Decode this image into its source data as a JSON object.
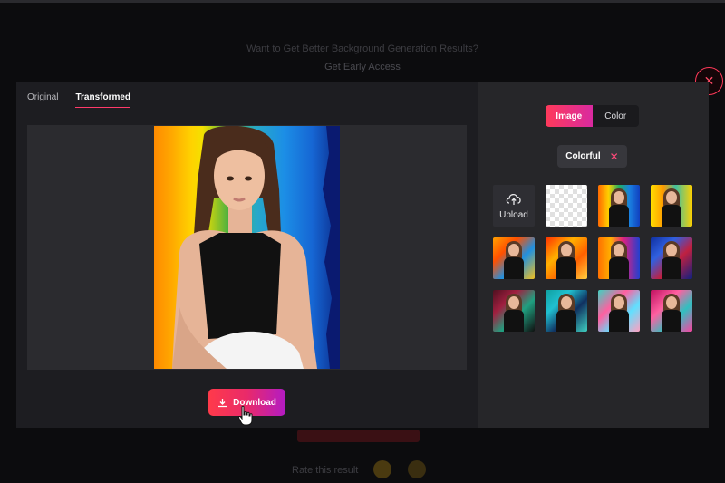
{
  "background": {
    "hint_line1": "Want to Get Better Background Generation Results?",
    "hint_line2": "Get Early Access",
    "feedback": "Rate this result"
  },
  "tabs": [
    {
      "label": "Original",
      "active": false
    },
    {
      "label": "Transformed",
      "active": true
    }
  ],
  "download": {
    "label": "Download"
  },
  "mode_switch": [
    {
      "label": "Image",
      "active": true
    },
    {
      "label": "Color",
      "active": false
    }
  ],
  "filter_chip": {
    "label": "Colorful"
  },
  "upload": {
    "label": "Upload"
  },
  "icons": {
    "close": "close-icon",
    "download": "download-icon",
    "upload": "cloud-upload-icon",
    "remove": "remove-filter-icon",
    "cursor": "hand-pointer-icon"
  },
  "colors": {
    "accent_start": "#ff3a4a",
    "accent_end": "#b31bc4",
    "panel_left": "#1d1d21",
    "panel_right": "#262629"
  },
  "background_tiles": [
    {
      "gradient": "linear-gradient(90deg,#ff6a00,#ffd000 25%,#20b060 50%,#1a80e0 75%,#1040c0)"
    },
    {
      "gradient": "linear-gradient(90deg,#ffe000,#ff9a00 30%,#40c0a0 60%,#ffd000)"
    },
    {
      "gradient": "linear-gradient(135deg,#ffa000,#ff5000 30%,#2090e0 60%,#f0c020)"
    },
    {
      "gradient": "linear-gradient(135deg,#ff3000,#ffb000 35%,#ff6000 65%,#ffd040)"
    },
    {
      "gradient": "linear-gradient(90deg,#ff7000,#ffb000 30%,#e02080 60%,#2040d0)"
    },
    {
      "gradient": "linear-gradient(135deg,#1030a0,#3060e0 30%,#c02040 60%,#102080)"
    },
    {
      "gradient": "linear-gradient(135deg,#501020,#a02040 30%,#20a080 60%,#101010)"
    },
    {
      "gradient": "linear-gradient(135deg,#10a0a0,#20c0d0 30%,#103060 60%,#40d0c0)"
    },
    {
      "gradient": "linear-gradient(135deg,#40d0c0,#ff60a0 35%,#60e0ff 65%,#ffa0c0)"
    },
    {
      "gradient": "linear-gradient(135deg,#c01060,#ff60a0 35%,#30c0c0 65%,#ff40a0)"
    }
  ]
}
